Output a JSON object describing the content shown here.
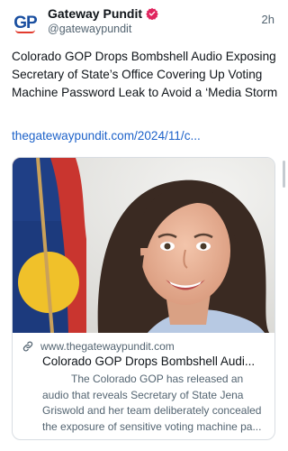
{
  "post": {
    "author": {
      "display_name": "Gateway Pundit",
      "handle": "@gatewaypundit",
      "avatar_initials": "GP",
      "verified_icon": "verified-badge-icon",
      "verified_color": "#e0245e"
    },
    "timestamp": "2h",
    "text": "Colorado GOP Drops Bombshell Audio Exposing Secretary of State’s Office Covering Up Voting Machine Password Leak to Avoid a ‘Media Storm",
    "link_text": "thegatewaypundit.com/2024/11/c...",
    "link_color": "#1d62c9"
  },
  "card": {
    "domain": "www.thegatewaypundit.com",
    "title": "Colorado GOP Drops Bombshell Audi...",
    "description": "The Colorado GOP has released an audio that reveals Secretary of State Jena Griswold and her team deliberately concealed the exposure of sensitive voting machine pa...",
    "link_icon": "link-icon"
  }
}
